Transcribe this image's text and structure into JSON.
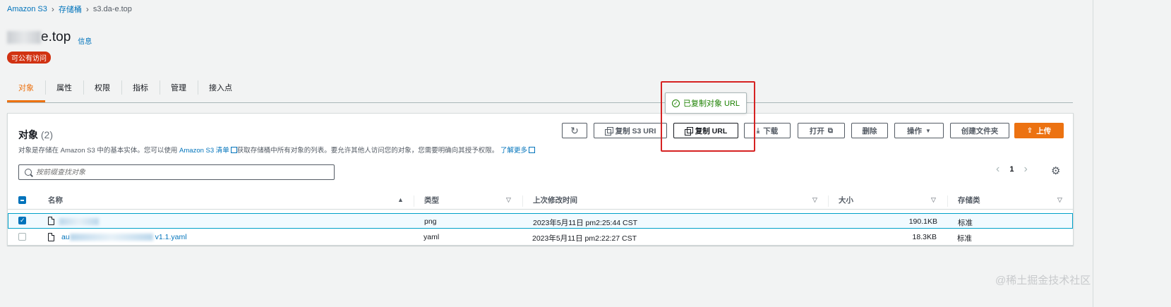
{
  "breadcrumb": {
    "root": "Amazon S3",
    "buckets": "存储桶",
    "current": "s3.da-e.top"
  },
  "bucket": {
    "name_visible": "e.top",
    "info_link": "信息",
    "badge": "可公有访问"
  },
  "tabs": [
    "对象",
    "属性",
    "权限",
    "指标",
    "管理",
    "接入点"
  ],
  "panel": {
    "title": "对象",
    "count": "(2)",
    "description_part1": "对象是存储在 Amazon S3 中的基本实体。您可以使用",
    "description_link1": "Amazon S3 清单",
    "description_part2": "获取存储桶中所有对象的列表。要允许其他人访问您的对象，您需要明确向其授予权限。",
    "description_link2": "了解更多"
  },
  "toolbar": {
    "copy_s3_uri": "复制 S3 URI",
    "copy_url": "复制 URL",
    "download": "下载",
    "open": "打开",
    "delete": "删除",
    "actions": "操作",
    "create_folder": "创建文件夹",
    "upload": "上传"
  },
  "tooltip": "已复制对象 URL",
  "search": {
    "placeholder": "按前缀查找对象"
  },
  "pagination": {
    "page": "1"
  },
  "table": {
    "headers": {
      "name": "名称",
      "type": "类型",
      "modified": "上次修改时间",
      "size": "大小",
      "storage": "存储类"
    },
    "rows": [
      {
        "name_suffix": "",
        "type": "png",
        "modified": "2023年5月11日 pm2:25:44 CST",
        "size": "190.1KB",
        "storage": "标准",
        "selected": true
      },
      {
        "name_prefix": "au",
        "name_suffix": "v1.1.yaml",
        "type": "yaml",
        "modified": "2023年5月11日 pm2:22:27 CST",
        "size": "18.3KB",
        "storage": "标准",
        "selected": false
      }
    ]
  },
  "watermark": "@稀土掘金技术社区",
  "colors": {
    "accent": "#ec7211",
    "link": "#0073bb",
    "success": "#1d8102",
    "danger": "#d13212",
    "highlight_box": "#d62222"
  }
}
